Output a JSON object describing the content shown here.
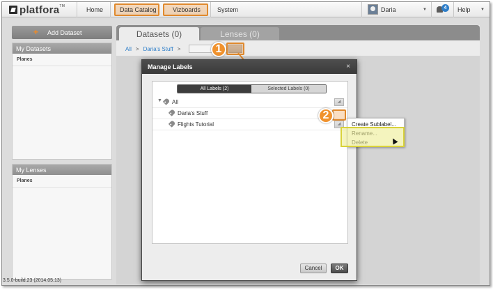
{
  "app": {
    "name": "platfora",
    "trademark": "TM"
  },
  "nav": {
    "home": "Home",
    "data_catalog": "Data Catalog",
    "vizboards": "Vizboards",
    "system": "System",
    "user": "Daria",
    "notifications_count": "4",
    "help": "Help"
  },
  "sidebar": {
    "add_dataset": "Add Dataset",
    "my_datasets": {
      "title": "My Datasets",
      "items": [
        "Planes"
      ]
    },
    "my_lenses": {
      "title": "My Lenses",
      "items": [
        "Planes"
      ]
    }
  },
  "main": {
    "tabs": [
      "Datasets (0)",
      "Lenses (0)"
    ],
    "breadcrumb": [
      "All",
      "Daria's Stuff"
    ]
  },
  "callouts": [
    "1",
    "2"
  ],
  "modal": {
    "title": "Manage Labels",
    "close": "×",
    "segment": {
      "all": "All Labels (2)",
      "selected": "Selected Labels (0)"
    },
    "tree": [
      {
        "label": "All"
      },
      {
        "label": "Daria's Stuff"
      },
      {
        "label": "Flights Tutorial"
      }
    ],
    "cancel": "Cancel",
    "ok": "OK"
  },
  "context_menu": {
    "items": [
      "Create Sublabel...",
      "Rename...",
      "Delete"
    ]
  },
  "version": "3.5.0-build.23 (2014.05.13)"
}
